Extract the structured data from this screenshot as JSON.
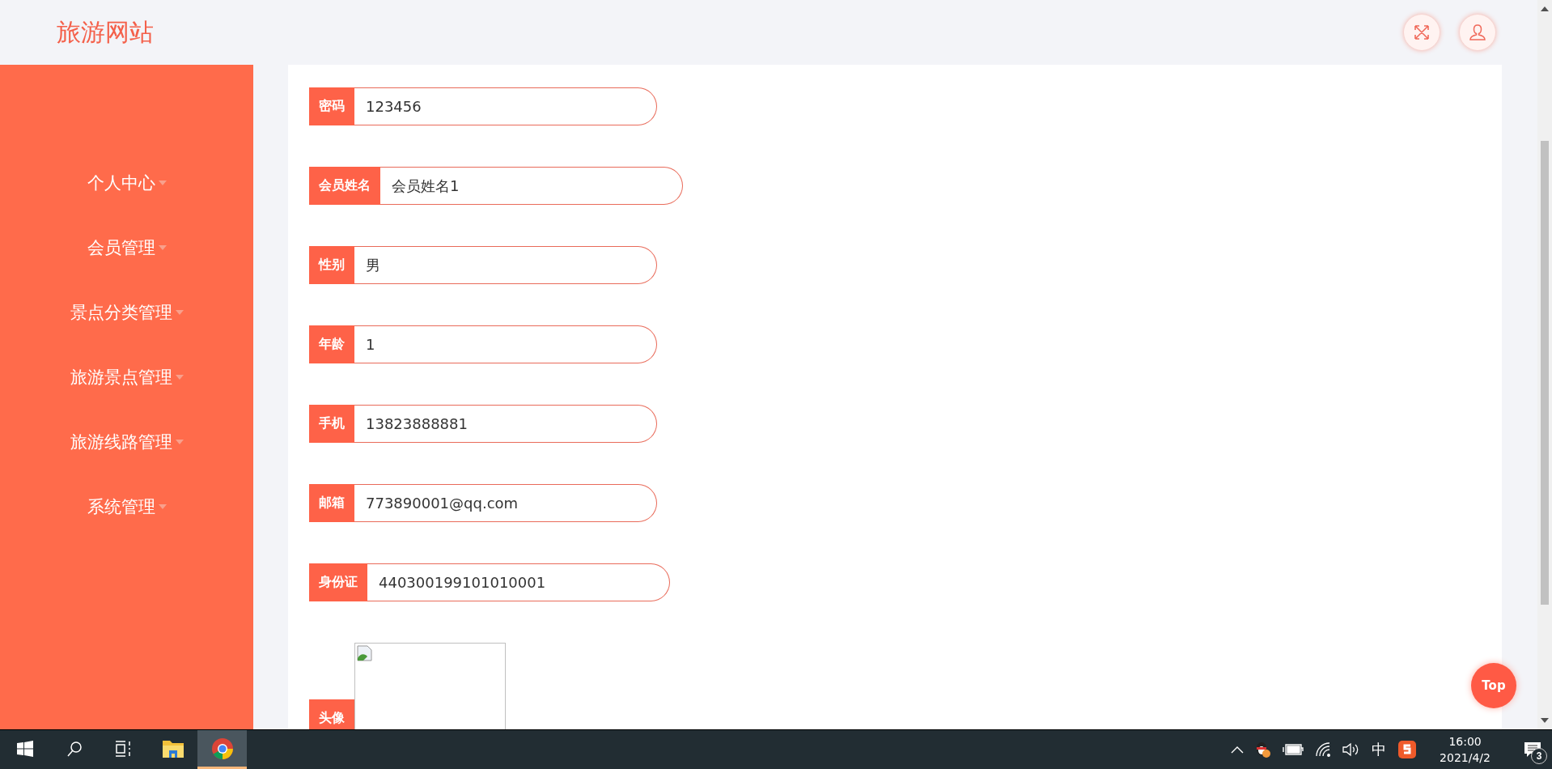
{
  "header": {
    "logo": "旅游网站"
  },
  "sidebar": {
    "items": [
      {
        "label": "个人中心"
      },
      {
        "label": "会员管理"
      },
      {
        "label": "景点分类管理"
      },
      {
        "label": "旅游景点管理"
      },
      {
        "label": "旅游线路管理"
      },
      {
        "label": "系统管理"
      }
    ]
  },
  "form": {
    "fields": [
      {
        "label": "密码",
        "value": "123456"
      },
      {
        "label": "会员姓名",
        "value": "会员姓名1"
      },
      {
        "label": "性别",
        "value": "男"
      },
      {
        "label": "年龄",
        "value": "1"
      },
      {
        "label": "手机",
        "value": "13823888881"
      },
      {
        "label": "邮箱",
        "value": "773890001@qq.com"
      },
      {
        "label": "身份证",
        "value": "440300199101010001"
      }
    ],
    "avatar": {
      "label": "头像"
    }
  },
  "back_to_top": "Top",
  "taskbar": {
    "apps": [
      {
        "kind": "explorer",
        "selected": false
      },
      {
        "kind": "chrome",
        "selected": true
      }
    ],
    "ime": "中",
    "time": "16:00",
    "date": "2021/4/2",
    "notifications": "3"
  }
}
